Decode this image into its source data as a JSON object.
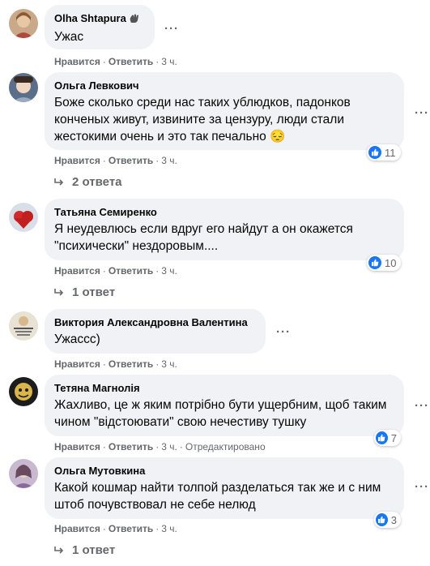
{
  "colors": {
    "bubble_bg": "#f0f2f5",
    "meta_text": "#65676b",
    "like_blue": "#1877f2"
  },
  "comments": [
    {
      "author": "Olha Shtapura",
      "badge_icon": "waving-hand-icon",
      "text": "Ужас",
      "actions": {
        "like": "Нравится",
        "reply": "Ответить",
        "time": "3 ч."
      }
    },
    {
      "author": "Ольга Левкович",
      "text": "Боже сколько среди нас таких ублюдков, падонков конченых живут, извините за цензуру, люди стали жестокими очень и это так печально 😔",
      "actions": {
        "like": "Нравится",
        "reply": "Ответить",
        "time": "3 ч."
      },
      "reaction_count": "11",
      "replies": "2 ответа"
    },
    {
      "author": "Татьяна Семиренко",
      "text": "Я неудевлюсь если вдруг его найдут а он окажется \"психически\" нездоровым....",
      "actions": {
        "like": "Нравится",
        "reply": "Ответить",
        "time": "3 ч."
      },
      "reaction_count": "10",
      "replies": "1 ответ"
    },
    {
      "author": "Виктория Александровна Валентина",
      "text": "Ужассс)",
      "actions": {
        "like": "Нравится",
        "reply": "Ответить",
        "time": "3 ч."
      }
    },
    {
      "author": "Тетяна Магнолія",
      "text": "Жахливо, це ж яким потрібно бути ущербним, щоб таким чином \"відстоювати\" свою нечестиву тушку",
      "actions": {
        "like": "Нравится",
        "reply": "Ответить",
        "time": "3 ч.",
        "edited": "Отредактировано"
      },
      "reaction_count": "7"
    },
    {
      "author": "Ольга Мутовкина",
      "text": "Какой кошмар найти толпой разделаться так же и с ним штоб почувствовал не себе нелюд",
      "actions": {
        "like": "Нравится",
        "reply": "Ответить",
        "time": "3 ч."
      },
      "reaction_count": "3",
      "replies": "1 ответ"
    }
  ],
  "icons": {
    "more": "more-options-icon",
    "reply_arrow": "reply-arrow-icon",
    "like": "like-thumb-icon"
  }
}
